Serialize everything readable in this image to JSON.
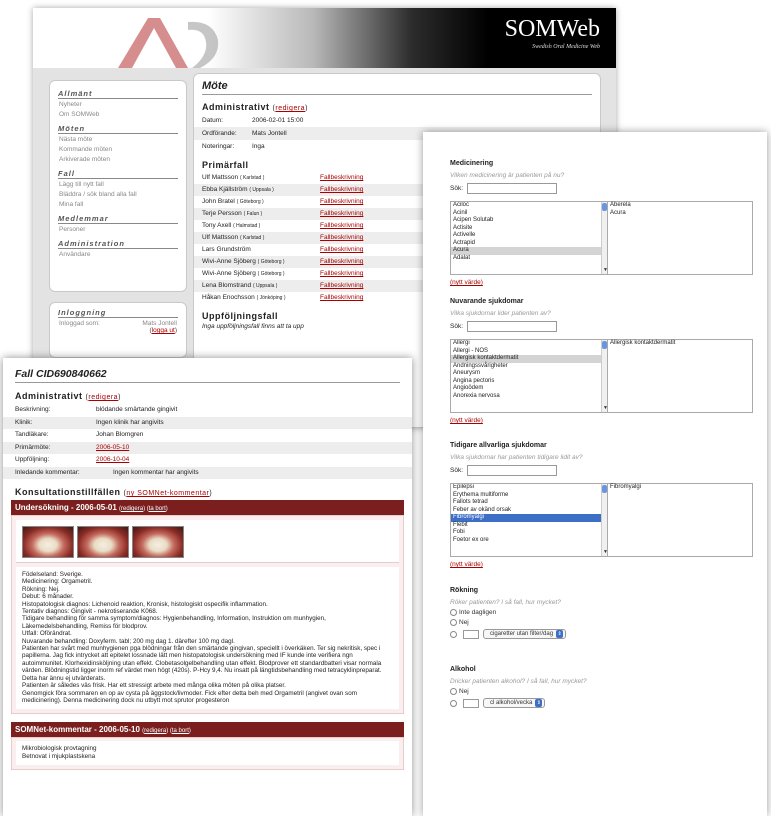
{
  "site": {
    "brand": "SOMWeb",
    "subtitle": "Swedish Oral Medicine Web"
  },
  "nav": {
    "sections": [
      {
        "heading": "Allmänt",
        "items": [
          "Nyheter",
          "Om SOMWeb"
        ]
      },
      {
        "heading": "Möten",
        "items": [
          "Nästa möte",
          "Kommande möten",
          "Arkiverade möten"
        ]
      },
      {
        "heading": "Fall",
        "items": [
          "Lägg till nytt fall",
          "Bläddra / sök bland alla fall",
          "Mina fall"
        ]
      },
      {
        "heading": "Medlemmar",
        "items": [
          "Personer"
        ]
      },
      {
        "heading": "Administration",
        "items": [
          "Användare"
        ]
      }
    ]
  },
  "login": {
    "heading": "Inloggning",
    "label": "Inloggad som:",
    "user": "Mats Jontell",
    "logout_open": "(",
    "logout": "logga ut",
    "logout_close": ")"
  },
  "meeting": {
    "title": "Möte",
    "admin_heading": "Administrativt",
    "edit_link": "redigera",
    "fields": [
      {
        "k": "Datum:",
        "v": "2006-02-01 15:00"
      },
      {
        "k": "Ordförande:",
        "v": "Mats Jontell"
      },
      {
        "k": "Noteringar:",
        "v": "Inga"
      }
    ],
    "primary_heading": "Primärfall",
    "cases": [
      {
        "name": "Ulf Mattsson",
        "city": "( Karlstad )",
        "link": "Fallbeskrivning"
      },
      {
        "name": "Ebba Kjällström",
        "city": "( Uppsala )",
        "link": "Fallbeskrivning"
      },
      {
        "name": "John Bratel",
        "city": "( Göteborg )",
        "link": "Fallbeskrivning"
      },
      {
        "name": "Terje Persson",
        "city": "( Falun )",
        "link": "Fallbeskrivning"
      },
      {
        "name": "Tony Axell",
        "city": "( Halmstad )",
        "link": "Fallbeskrivning"
      },
      {
        "name": "Ulf Mattsson",
        "city": "( Karlstad )",
        "link": "Fallbeskrivning"
      },
      {
        "name": "Lars Grundström",
        "city": "",
        "link": "Fallbeskrivning"
      },
      {
        "name": "Wivi-Anne Sjöberg",
        "city": "( Göteborg )",
        "link": "Fallbeskrivning"
      },
      {
        "name": "Wivi-Anne Sjöberg",
        "city": "( Göteborg )",
        "link": "Fallbeskrivning"
      },
      {
        "name": "Lena Blomstrand",
        "city": "( Uppsala )",
        "link": "Fallbeskrivning"
      },
      {
        "name": "Håkan Enochsson",
        "city": "( Jönköping )",
        "link": "Fallbeskrivning"
      }
    ],
    "followup_heading": "Uppföljningsfall",
    "followup_note": "Inga uppföljningsfall finns att ta upp"
  },
  "form": {
    "search_label": "Sök:",
    "new_value": "(nytt värde)",
    "medication": {
      "title": "Medicinering",
      "question": "Vilken medicinering är patienten på nu?",
      "options": [
        "Aciloc",
        "Acinil",
        "Acipen Solutab",
        "Actisite",
        "Activelle",
        "Actrapid",
        "Acura",
        "Adalat"
      ],
      "selected": [
        "Aberela",
        "Acura"
      ]
    },
    "diseases": {
      "title": "Nuvarande sjukdomar",
      "question": "Vilka sjukdomar lider patienten av?",
      "options": [
        "Allergi",
        "Allergi - NOS",
        "Allergisk kontaktdermatit",
        "Andningssvårigheter",
        "Aneurysm",
        "Angina pectoris",
        "Angioödem",
        "Anorexia nervosa"
      ],
      "selected": [
        "Allergisk kontaktdermatit"
      ]
    },
    "serious": {
      "title": "Tidigare allvarliga sjukdomar",
      "question": "Vilka sjukdomar har patienten tidigare lidit av?",
      "options": [
        "Epilepsi",
        "Erythema multiforme",
        "Fallots tetrad",
        "Feber av okänd orsak",
        "Fibromyalgi",
        "Flebit",
        "Fobi",
        "Foetor ex ore"
      ],
      "selected": [
        "Fibromyalgi"
      ]
    },
    "smoking": {
      "title": "Rökning",
      "question": "Röker patienten? I så fall, hur mycket?",
      "opt1": "Inte dagligen",
      "opt2": "Nej",
      "unit": "cigaretter utan filter/dag"
    },
    "alcohol": {
      "title": "Alkohol",
      "question": "Dricker patienten alkohol? I så fall, hur mycket?",
      "opt1": "Nej",
      "unit": "cl alkohol/vecka"
    }
  },
  "case": {
    "title": "Fall CID690840662",
    "admin_heading": "Administrativt",
    "edit_link": "redigera",
    "fields": [
      {
        "k": "Beskrivning:",
        "v": "blödande smärtande gingivit"
      },
      {
        "k": "Klinik:",
        "v": "Ingen klinik har angivits"
      },
      {
        "k": "Tandläkare:",
        "v": "Johan Blomgren"
      },
      {
        "k": "Primärmöte:",
        "v": "2006-05-10"
      },
      {
        "k": "Uppföljning:",
        "v": "2006-10-04"
      }
    ],
    "initial_comment_label": "Inledande kommentar:",
    "initial_comment_value": "Ingen kommentar har angivits",
    "consult_heading": "Konsultationstillfällen",
    "new_comment_link": "ny SOMNet-kommentar",
    "exam_title": "Undersökning - 2006-05-01",
    "exam_edit": "redigera",
    "exam_delete": "ta bort",
    "exam_notes": [
      "Födelseland: Sverige.",
      "Medicinering: Orgametril.",
      "Rökning: Nej.",
      "Debut: 6 månader.",
      "Histopatologisk diagnos: Lichenoid reaktion, Kronisk, histologiskt ospecifik inflammation.",
      "Tentativ diagnos: Gingivit - nekrotiserande K068.",
      "Tidigare behandling för samma symptom/diagnos: Hygienbehandling, Information, Instruktion om munhygien, Läkemedelsbehandling, Remiss för blodprov.",
      "Utfall: Oförändrat.",
      "Nuvarande behandling: Doxyferm. tabl; 200 mg dag 1. därefter 100 mg dagl.",
      "Patienten har svårt med munhygienen pga blödningar från den smärtande gingivan, speciellt i överkäken. Ter sig nekritisk, spec i papillerna. Jag fick intrycket att epitelet lossnade lätt men histopatologisk undersökning med IF kunde inte verifiera ngn autoimmunitet. Klorhexidinsköljning utan effekt. Clobetasolgelbehandling utan effekt. Blodprover ett standardbatteri visar normala värden. Blödningstid ligger inorm ref värdet men högt (420s). P-Hcy 9,4. Nu insatt på längtidsbehandling med tetracyklinpreparat. Detta har ännu ej utvärderats.",
      "Patienten är således väs frisk. Har ett stressigt arbete med många olika möten på olika platser.",
      "Genomgick föra sommaren en op av cysta på äggstock/livmoder. Fick efter detta beh med Orgametril (angivet ovan som medicinering). Denna medicinering dock nu utbytt mot sprutor progesteron"
    ],
    "somnet_title": "SOMNet-kommentar - 2006-05-10",
    "somnet_edit": "redigera",
    "somnet_delete": "ta bort",
    "somnet_notes": [
      "Mikrobiologisk provtagning",
      "Betnovat i mjukplastskena"
    ]
  }
}
